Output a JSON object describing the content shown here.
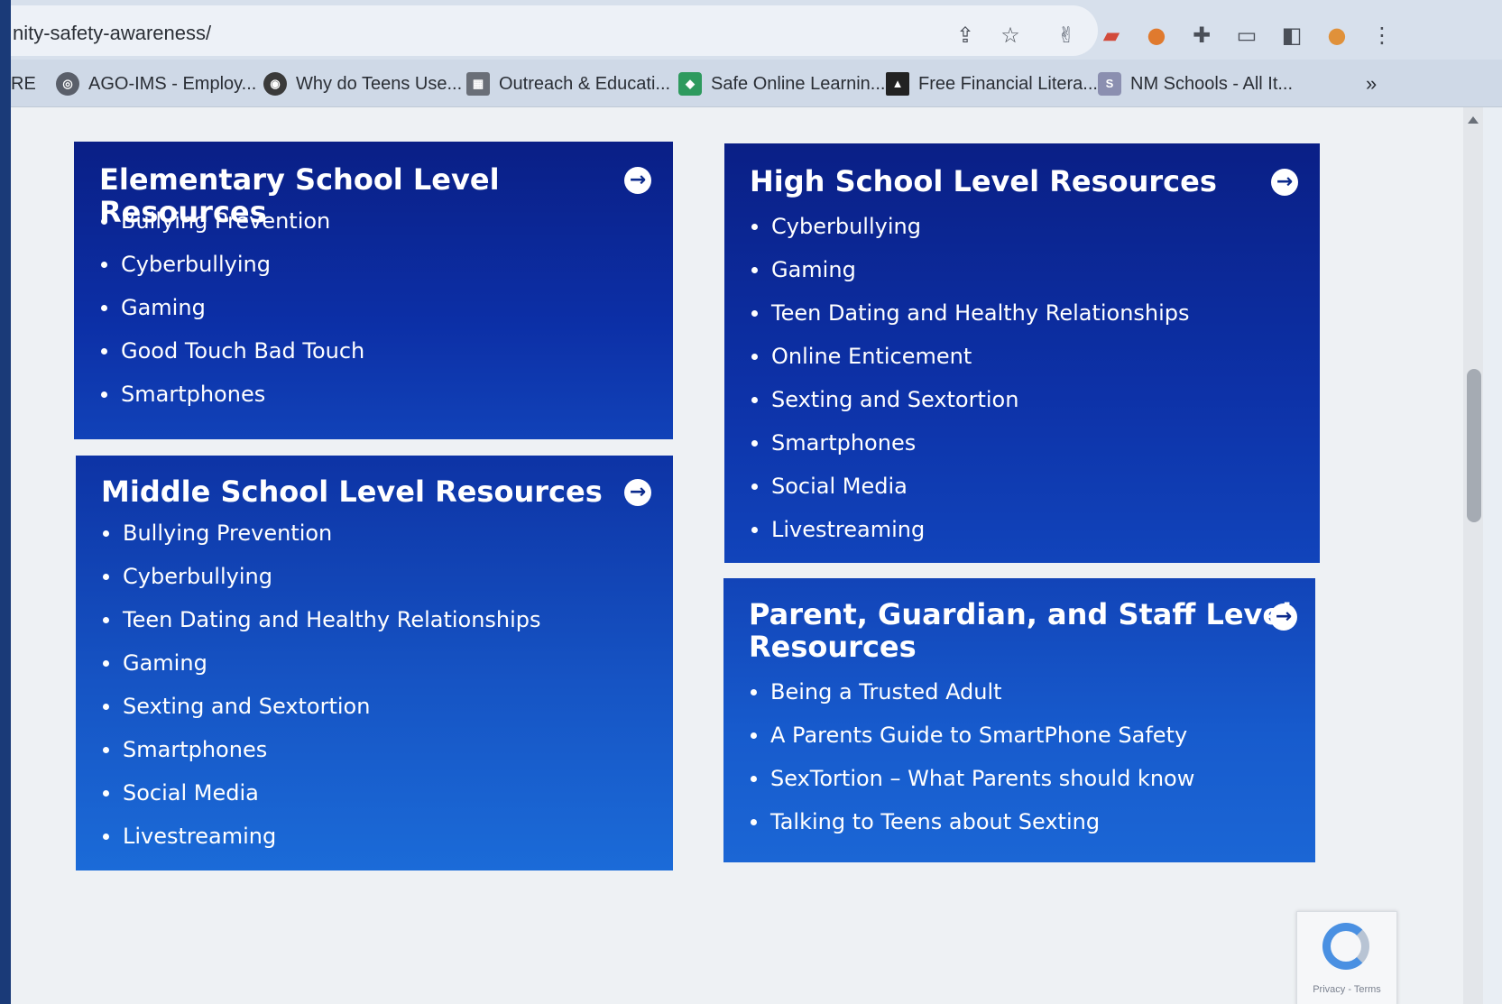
{
  "browser": {
    "url": "nity-safety-awareness/",
    "bookmarks": [
      {
        "label": "RE"
      },
      {
        "label": "AGO-IMS - Employ..."
      },
      {
        "label": "Why do Teens Use..."
      },
      {
        "label": "Outreach & Educati..."
      },
      {
        "label": "Safe Online Learnin..."
      },
      {
        "label": "Free Financial Litera..."
      },
      {
        "label": "NM Schools - All It..."
      }
    ],
    "overflow_label": "»"
  },
  "cards": {
    "elementary": {
      "title": "Elementary School Level Resources",
      "items": [
        "Bullying Prevention",
        "Cyberbullying",
        "Gaming",
        "Good Touch Bad Touch",
        "Smartphones"
      ]
    },
    "middle": {
      "title": "Middle School Level Resources",
      "items": [
        "Bullying Prevention",
        "Cyberbullying",
        "Teen Dating and Healthy Relationships",
        "Gaming",
        "Sexting and Sextortion",
        "Smartphones",
        "Social Media",
        "Livestreaming"
      ]
    },
    "high": {
      "title": "High School Level Resources",
      "items": [
        "Cyberbullying",
        "Gaming",
        "Teen Dating and Healthy Relationships",
        "Online Enticement",
        "Sexting and Sextortion",
        "Smartphones",
        "Social Media",
        "Livestreaming"
      ]
    },
    "parent": {
      "title_line1": "Parent, Guardian, and Staff Level",
      "title_line2": "Resources",
      "items": [
        "Being a Trusted Adult",
        "A Parents Guide to SmartPhone Safety",
        "SexTortion – What Parents should know",
        "Talking to Teens about Sexting"
      ]
    }
  },
  "recaptcha": {
    "text": "Privacy - Terms"
  },
  "colors": {
    "card_dark": "#0a1f86",
    "card_light": "#1b6bd8",
    "page_bg": "#eef1f4"
  }
}
